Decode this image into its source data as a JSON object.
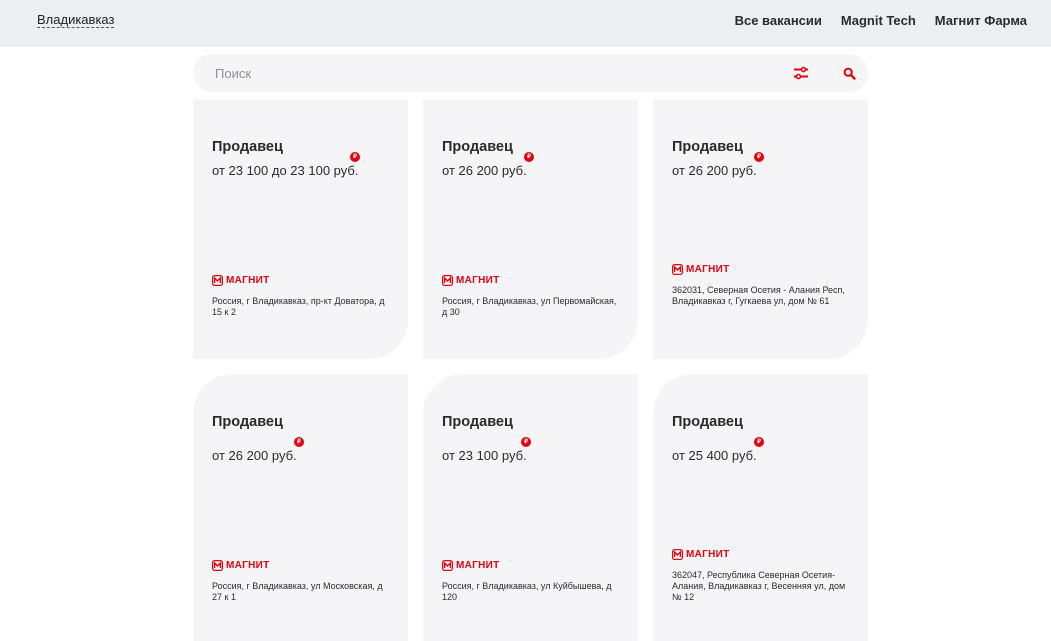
{
  "header": {
    "city": "Владикавказ",
    "nav": [
      "Все вакансии",
      "Magnit Tech",
      "Магнит Фарма"
    ]
  },
  "search": {
    "placeholder": "Поиск",
    "filter_icon": "filter-sliders-icon",
    "search_icon": "search-icon"
  },
  "colors": {
    "accent": "#e3000f",
    "card_bg": "#f5f5f7",
    "header_bg": "#eceef1"
  },
  "vacancies": [
    {
      "title": "Продавец",
      "currency_badge": "₽",
      "salary": "от 23 100 до 23 100 руб.",
      "brand": "МАГНИТ",
      "address": "Россия, г Владикавказ, пр-кт Доватора, д 15 к 2"
    },
    {
      "title": "Продавец",
      "currency_badge": "₽",
      "salary": "от 26 200 руб.",
      "brand": "МАГНИТ",
      "address": "Россия, г Владикавказ, ул Первомайская, д 30"
    },
    {
      "title": "Продавец",
      "currency_badge": "₽",
      "salary": "от 26 200 руб.",
      "brand": "МАГНИТ",
      "address": "362031, Северная Осетия - Алания Респ, Владикавказ г, Гугкаева ул, дом № 61"
    },
    {
      "title": "Продавец",
      "currency_badge": "₽",
      "salary": "от 26 200 руб.",
      "brand": "МАГНИТ",
      "address": "Россия, г Владикавказ, ул Московская, д 27 к 1"
    },
    {
      "title": "Продавец",
      "currency_badge": "₽",
      "salary": "от 23 100 руб.",
      "brand": "МАГНИТ",
      "address": "Россия, г Владикавказ, ул Куйбышева, д 120"
    },
    {
      "title": "Продавец",
      "currency_badge": "₽",
      "salary": "от 25 400 руб.",
      "brand": "МАГНИТ",
      "address": "362047, Республика Северная Осетия-Алания, Владикавказ г, Весенняя ул, дом № 12"
    }
  ]
}
